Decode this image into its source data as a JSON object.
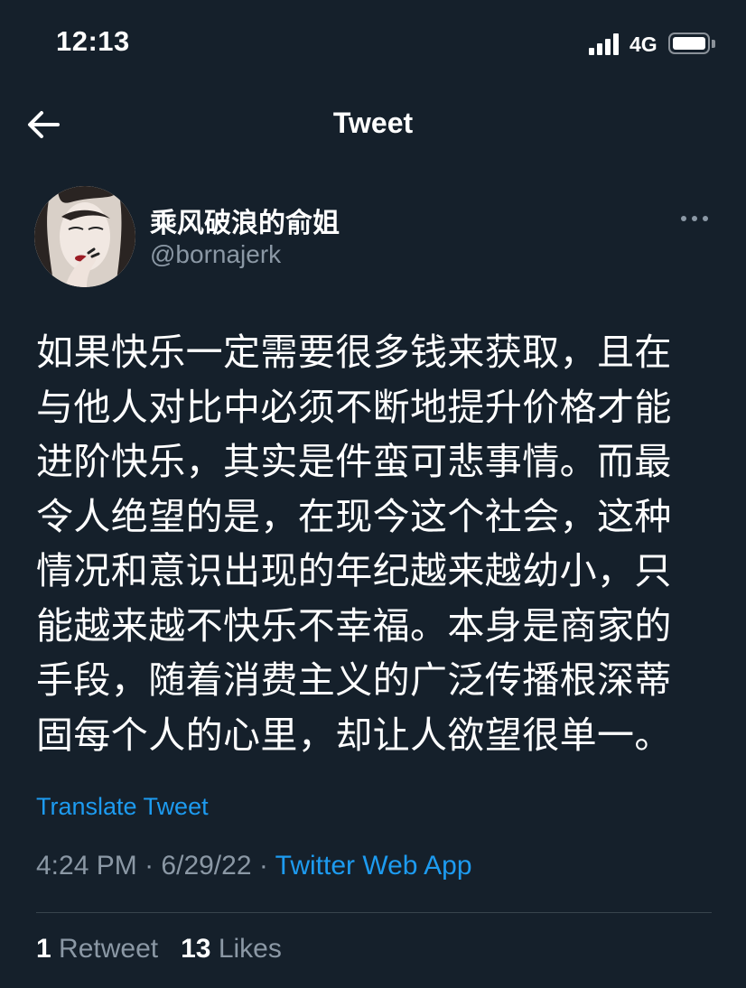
{
  "status_bar": {
    "time": "12:13",
    "network": "4G",
    "battery_level": 0.9
  },
  "header": {
    "title": "Tweet",
    "back_icon": "arrow-left-icon"
  },
  "author": {
    "display_name": "乘风破浪的俞姐",
    "handle": "@bornajerk",
    "more_icon": "more-dots-icon"
  },
  "tweet": {
    "lines": [
      "如果快乐一定需要很多钱来获取，且在",
      "与他人对比中必须不断地提升价格才能",
      "进阶快乐，其实是件蛮可悲事情。而最",
      "令人绝望的是，在现今这个社会，这种",
      "情况和意识出现的年纪越来越幼小，只",
      "能越来越不快乐不幸福。本身是商家的",
      "手段，随着消费主义的广泛传播根深蒂",
      "固每个人的心里，却让人欲望很单一。"
    ],
    "translate_label": "Translate Tweet",
    "time": "4:24 PM",
    "date": "6/29/22",
    "separator": "·",
    "source": "Twitter Web App"
  },
  "stats": {
    "retweets_count": "1",
    "retweets_label": "Retweet",
    "likes_count": "13",
    "likes_label": "Likes"
  },
  "colors": {
    "background": "#15202b",
    "accent": "#1d9bf0",
    "secondary_text": "#8b98a5",
    "divider": "#38444d"
  }
}
